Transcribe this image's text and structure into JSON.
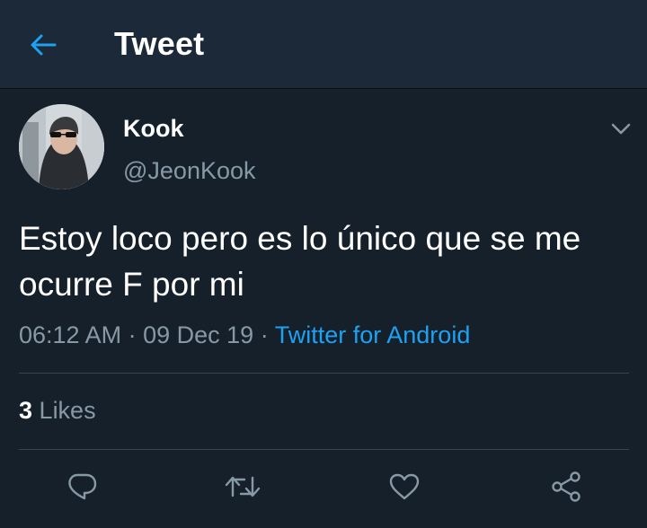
{
  "header": {
    "title": "Tweet",
    "back_icon": "arrow-left-icon"
  },
  "tweet": {
    "author_name": "Kook",
    "author_handle": "@JeonKook",
    "text": "Estoy loco pero es lo único que se me ocurre F por mi",
    "time": "06:12 AM",
    "date": "09 Dec 19",
    "separator": "·",
    "source": "Twitter for Android",
    "likes_count": "3",
    "likes_label": "Likes"
  },
  "actions": {
    "reply_icon": "reply-icon",
    "retweet_icon": "retweet-icon",
    "like_icon": "heart-icon",
    "share_icon": "share-icon"
  },
  "colors": {
    "background": "#15202b",
    "header_background": "#1c2938",
    "accent": "#1da1f2",
    "secondary_text": "#8899a6",
    "divider": "#38444d"
  }
}
